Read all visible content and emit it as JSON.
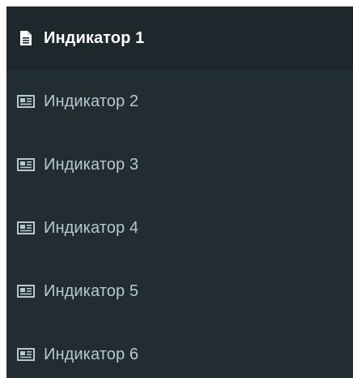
{
  "colors": {
    "sidebar_bg": "#222d32",
    "active_bg": "#1e282c",
    "active_text": "#ffffff",
    "inactive_text": "#b8c7ce"
  },
  "menu": {
    "items": [
      {
        "label": "Индикатор 1",
        "icon": "file-text-icon",
        "active": true
      },
      {
        "label": "Индикатор 2",
        "icon": "newspaper-icon",
        "active": false
      },
      {
        "label": "Индикатор 3",
        "icon": "newspaper-icon",
        "active": false
      },
      {
        "label": "Индикатор 4",
        "icon": "newspaper-icon",
        "active": false
      },
      {
        "label": "Индикатор 5",
        "icon": "newspaper-icon",
        "active": false
      },
      {
        "label": "Индикатор 6",
        "icon": "newspaper-icon",
        "active": false
      }
    ]
  }
}
